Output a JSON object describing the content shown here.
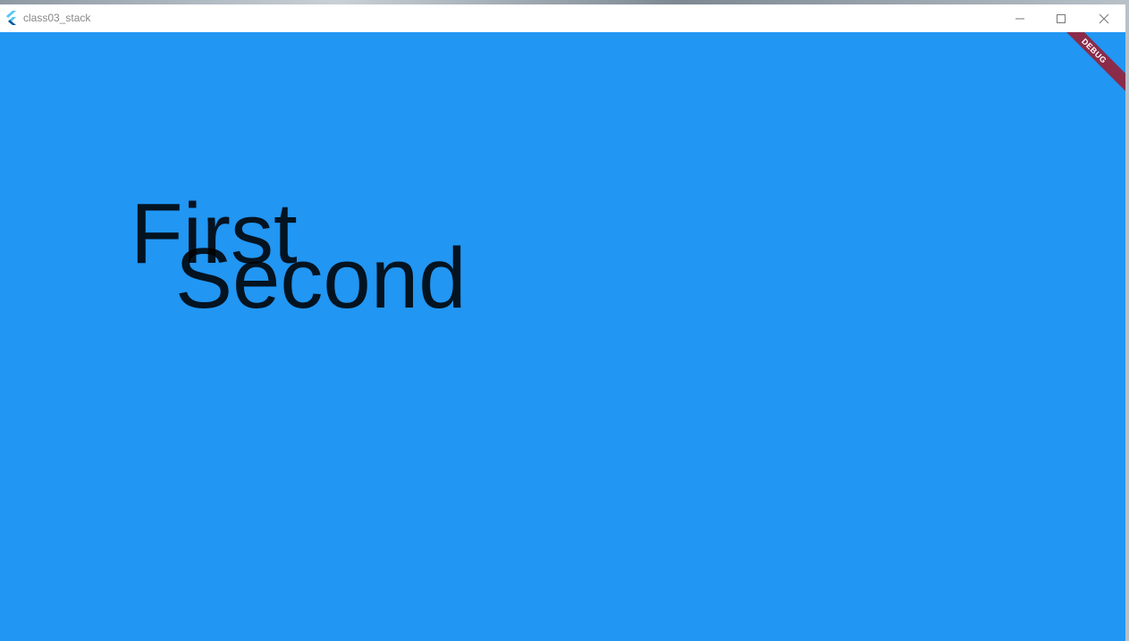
{
  "window": {
    "title": "class03_stack",
    "app_icon": "flutter-logo-icon"
  },
  "controls": {
    "minimize": "minimize-icon",
    "maximize": "maximize-icon",
    "close": "close-icon"
  },
  "content": {
    "background": "#2196F3",
    "first_text": "First",
    "second_text": "Second"
  },
  "debug_banner": {
    "label": "DEBUG",
    "color": "#8a2b4a"
  }
}
